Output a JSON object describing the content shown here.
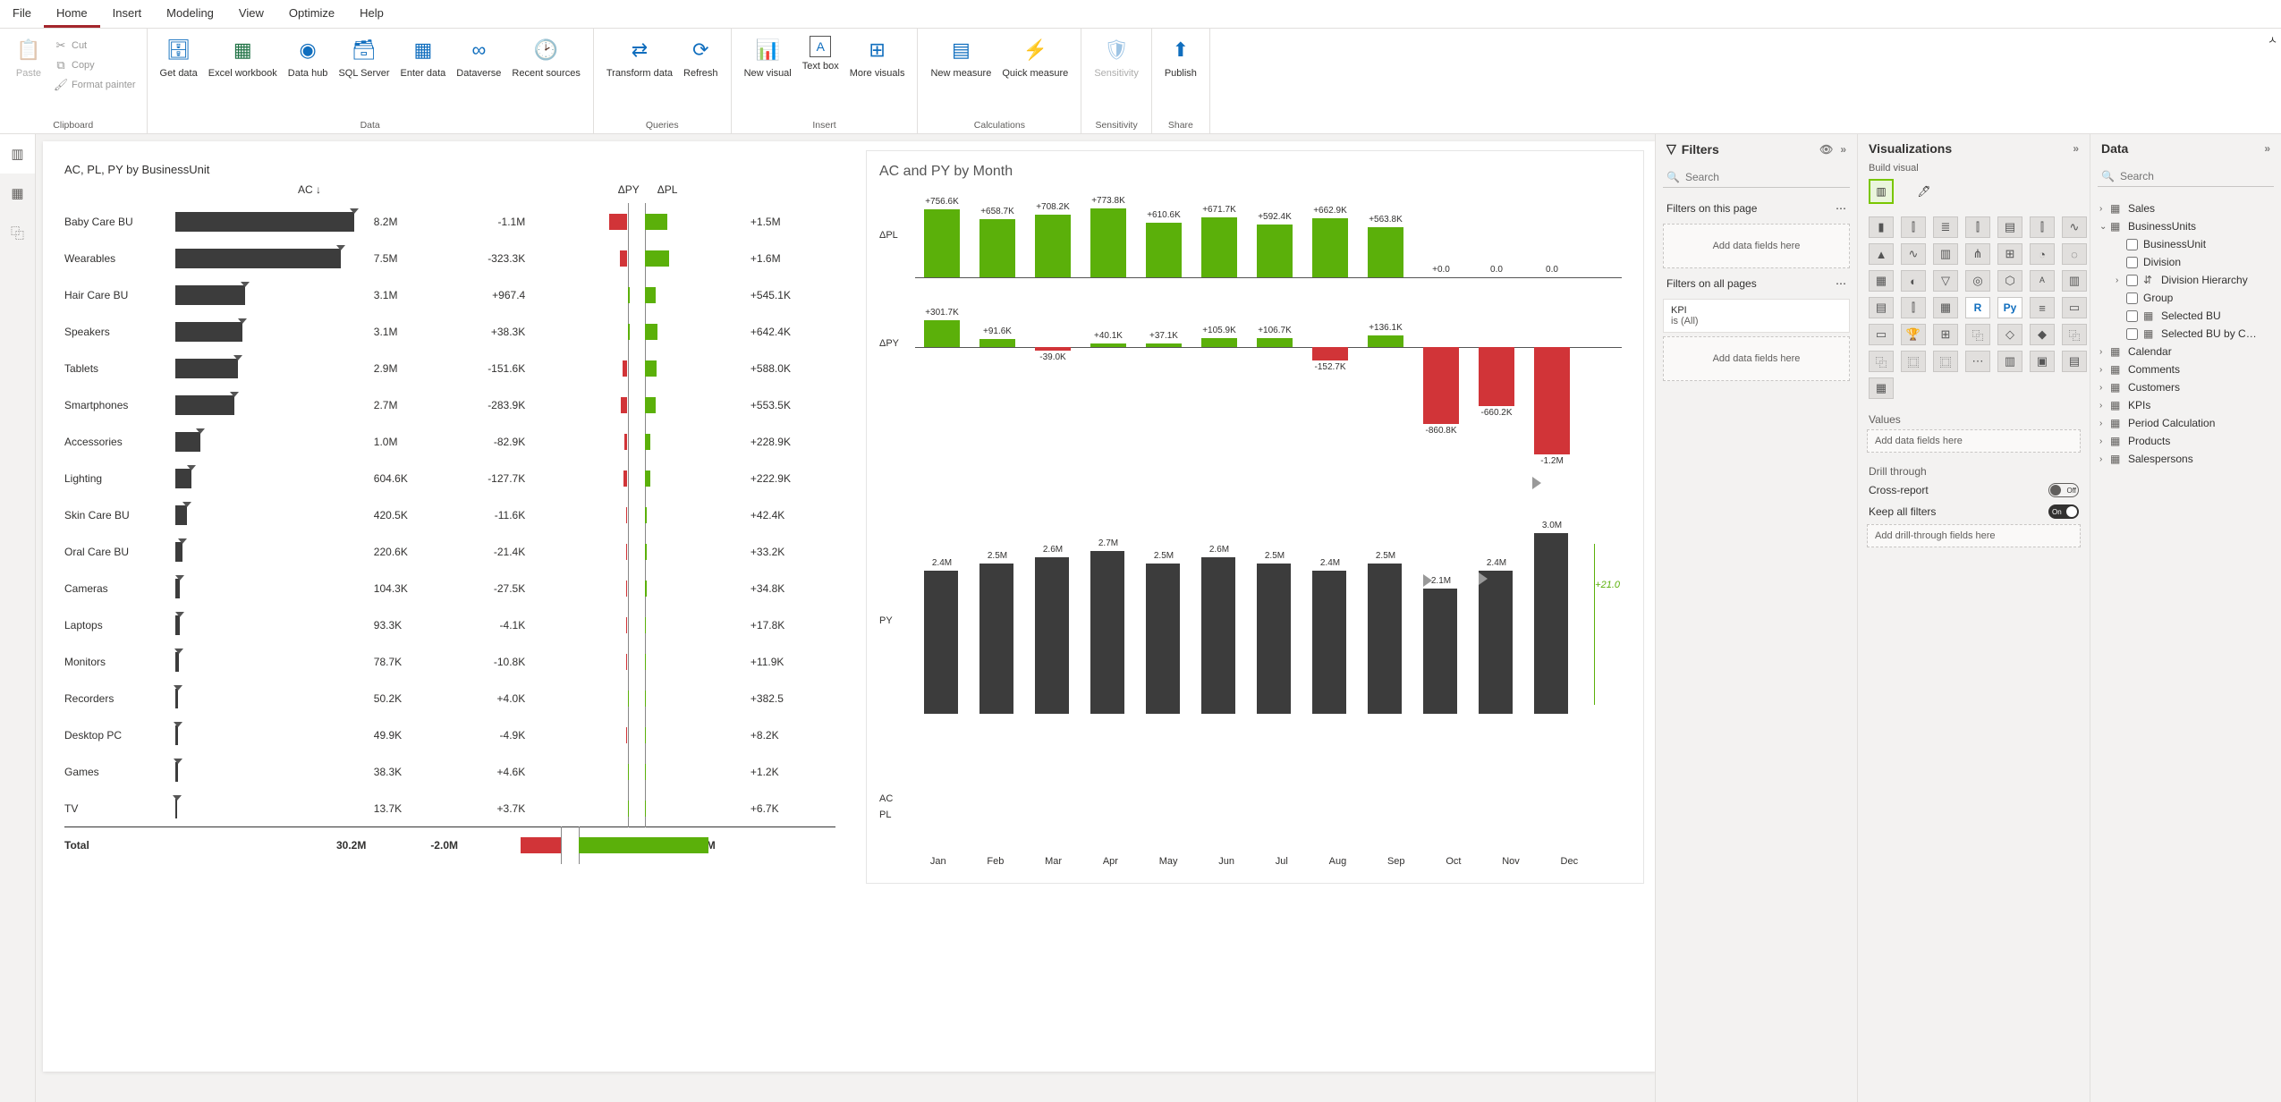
{
  "tabs": [
    "File",
    "Home",
    "Insert",
    "Modeling",
    "View",
    "Optimize",
    "Help"
  ],
  "active_tab": "Home",
  "ribbon": {
    "clipboard": {
      "paste": "Paste",
      "cut": "Cut",
      "copy": "Copy",
      "format_painter": "Format painter",
      "label": "Clipboard"
    },
    "data": {
      "get_data": "Get\ndata",
      "excel": "Excel\nworkbook",
      "data_hub": "Data\nhub",
      "sql": "SQL\nServer",
      "enter": "Enter\ndata",
      "dataverse": "Dataverse",
      "recent": "Recent\nsources",
      "label": "Data"
    },
    "queries": {
      "transform": "Transform\ndata",
      "refresh": "Refresh",
      "label": "Queries"
    },
    "insert": {
      "new_visual": "New\nvisual",
      "text_box": "Text\nbox",
      "more": "More\nvisuals",
      "label": "Insert"
    },
    "calc": {
      "new_measure": "New\nmeasure",
      "quick": "Quick\nmeasure",
      "label": "Calculations"
    },
    "sens": {
      "sensitivity": "Sensitivity",
      "label": "Sensitivity"
    },
    "share": {
      "publish": "Publish",
      "label": "Share"
    }
  },
  "filters_pane": {
    "title": "Filters",
    "search_ph": "Search",
    "on_page": "Filters on this page",
    "add_here": "Add data fields here",
    "on_all": "Filters on all pages",
    "kpi_name": "KPI",
    "kpi_val": "is (All)"
  },
  "viz_pane": {
    "title": "Visualizations",
    "build": "Build visual",
    "values": "Values",
    "values_ph": "Add data fields here",
    "drill": "Drill through",
    "cross": "Cross-report",
    "keep": "Keep all filters",
    "drill_ph": "Add drill-through fields here",
    "off": "Off",
    "on": "On"
  },
  "data_pane": {
    "title": "Data",
    "search_ph": "Search",
    "tables": [
      {
        "name": "Sales",
        "expanded": false
      },
      {
        "name": "BusinessUnits",
        "expanded": true,
        "children": [
          {
            "name": "BusinessUnit"
          },
          {
            "name": "Division"
          },
          {
            "name": "Division Hierarchy",
            "icon": "hier"
          },
          {
            "name": "Group"
          },
          {
            "name": "Selected BU",
            "icon": "table"
          },
          {
            "name": "Selected BU by C…",
            "icon": "table"
          }
        ]
      },
      {
        "name": "Calendar",
        "expanded": false
      },
      {
        "name": "Comments",
        "expanded": false
      },
      {
        "name": "Customers",
        "expanded": false
      },
      {
        "name": "KPIs",
        "expanded": false
      },
      {
        "name": "Period Calculation",
        "expanded": false
      },
      {
        "name": "Products",
        "expanded": false
      },
      {
        "name": "Salespersons",
        "expanded": false
      }
    ]
  },
  "viz_left": {
    "title": "AC, PL, PY by BusinessUnit",
    "headers": {
      "ac": "AC ↓",
      "dpy": "ΔPY",
      "dpl": "ΔPL"
    },
    "rows": [
      {
        "bu": "Baby Care BU",
        "ac": "8.2M",
        "bar": 200,
        "dpy": "-1.1M",
        "dpy_w": -20,
        "dpl": "+1.5M",
        "dpl_w": 25
      },
      {
        "bu": "Wearables",
        "ac": "7.5M",
        "bar": 185,
        "dpy": "-323.3K",
        "dpy_w": -8,
        "dpl": "+1.6M",
        "dpl_w": 27
      },
      {
        "bu": "Hair Care BU",
        "ac": "3.1M",
        "bar": 78,
        "dpy": "+967.4",
        "dpy_w": 2,
        "dpl": "+545.1K",
        "dpl_w": 12
      },
      {
        "bu": "Speakers",
        "ac": "3.1M",
        "bar": 75,
        "dpy": "+38.3K",
        "dpy_w": 2,
        "dpl": "+642.4K",
        "dpl_w": 14
      },
      {
        "bu": "Tablets",
        "ac": "2.9M",
        "bar": 70,
        "dpy": "-151.6K",
        "dpy_w": -5,
        "dpl": "+588.0K",
        "dpl_w": 13
      },
      {
        "bu": "Smartphones",
        "ac": "2.7M",
        "bar": 66,
        "dpy": "-283.9K",
        "dpy_w": -7,
        "dpl": "+553.5K",
        "dpl_w": 12
      },
      {
        "bu": "Accessories",
        "ac": "1.0M",
        "bar": 28,
        "dpy": "-82.9K",
        "dpy_w": -3,
        "dpl": "+228.9K",
        "dpl_w": 6
      },
      {
        "bu": "Lighting",
        "ac": "604.6K",
        "bar": 18,
        "dpy": "-127.7K",
        "dpy_w": -4,
        "dpl": "+222.9K",
        "dpl_w": 6
      },
      {
        "bu": "Skin Care BU",
        "ac": "420.5K",
        "bar": 13,
        "dpy": "-11.6K",
        "dpy_w": -1,
        "dpl": "+42.4K",
        "dpl_w": 2
      },
      {
        "bu": "Oral Care BU",
        "ac": "220.6K",
        "bar": 8,
        "dpy": "-21.4K",
        "dpy_w": -1,
        "dpl": "+33.2K",
        "dpl_w": 2
      },
      {
        "bu": "Cameras",
        "ac": "104.3K",
        "bar": 5,
        "dpy": "-27.5K",
        "dpy_w": -1,
        "dpl": "+34.8K",
        "dpl_w": 2
      },
      {
        "bu": "Laptops",
        "ac": "93.3K",
        "bar": 5,
        "dpy": "-4.1K",
        "dpy_w": -1,
        "dpl": "+17.8K",
        "dpl_w": 1
      },
      {
        "bu": "Monitors",
        "ac": "78.7K",
        "bar": 4,
        "dpy": "-10.8K",
        "dpy_w": -1,
        "dpl": "+11.9K",
        "dpl_w": 1
      },
      {
        "bu": "Recorders",
        "ac": "50.2K",
        "bar": 3,
        "dpy": "+4.0K",
        "dpy_w": 1,
        "dpl": "+382.5",
        "dpl_w": 1
      },
      {
        "bu": "Desktop PC",
        "ac": "49.9K",
        "bar": 3,
        "dpy": "-4.9K",
        "dpy_w": -1,
        "dpl": "+8.2K",
        "dpl_w": 1
      },
      {
        "bu": "Games",
        "ac": "38.3K",
        "bar": 3,
        "dpy": "+4.6K",
        "dpy_w": 1,
        "dpl": "+1.2K",
        "dpl_w": 1
      },
      {
        "bu": "TV",
        "ac": "13.7K",
        "bar": 2,
        "dpy": "+3.7K",
        "dpy_w": 1,
        "dpl": "+6.7K",
        "dpl_w": 1
      }
    ],
    "total": {
      "label": "Total",
      "ac": "30.2M",
      "dpy": "-2.0M",
      "dpy_w": -45,
      "dpl": "+6.0M",
      "dpl_w": 145
    }
  },
  "viz_right": {
    "title": "AC and PY by Month",
    "labels": {
      "dpl": "ΔPL",
      "dpy": "ΔPY",
      "py": "PY",
      "ac": "AC",
      "pl": "PL",
      "delta": "+21.0"
    },
    "months": [
      "Jan",
      "Feb",
      "Mar",
      "Apr",
      "May",
      "Jun",
      "Jul",
      "Aug",
      "Sep",
      "Oct",
      "Nov",
      "Dec"
    ],
    "dpl": [
      "+756.6K",
      "+658.7K",
      "+708.2K",
      "+773.8K",
      "+610.6K",
      "+671.7K",
      "+592.4K",
      "+662.9K",
      "+563.8K",
      "+0.0",
      "0.0",
      "0.0"
    ],
    "dpl_h": [
      76,
      65,
      70,
      77,
      61,
      67,
      59,
      66,
      56,
      0,
      0,
      0
    ],
    "dpy": [
      "+301.7K",
      "+91.6K",
      "-39.0K",
      "+40.1K",
      "+37.1K",
      "+105.9K",
      "+106.7K",
      "-152.7K",
      "+136.1K",
      "-860.8K",
      "-660.2K",
      "-1.2M"
    ],
    "dpy_h": [
      30,
      9,
      -4,
      4,
      4,
      10,
      10,
      -15,
      13,
      -86,
      -66,
      -120
    ],
    "ac_vals": [
      "2.4M",
      "2.5M",
      "2.6M",
      "2.7M",
      "2.5M",
      "2.6M",
      "2.5M",
      "2.4M",
      "2.5M",
      "2.1M",
      "2.4M",
      "3.0M"
    ],
    "ac_h": [
      160,
      168,
      175,
      182,
      168,
      175,
      168,
      160,
      168,
      140,
      160,
      202
    ]
  },
  "chart_data": [
    {
      "type": "bar",
      "title": "AC, PL, PY by BusinessUnit",
      "categories": [
        "Baby Care BU",
        "Wearables",
        "Hair Care BU",
        "Speakers",
        "Tablets",
        "Smartphones",
        "Accessories",
        "Lighting",
        "Skin Care BU",
        "Oral Care BU",
        "Cameras",
        "Laptops",
        "Monitors",
        "Recorders",
        "Desktop PC",
        "Games",
        "TV",
        "Total"
      ],
      "series": [
        {
          "name": "AC",
          "values": [
            8200000,
            7500000,
            3100000,
            3100000,
            2900000,
            2700000,
            1000000,
            604600,
            420500,
            220600,
            104300,
            93300,
            78700,
            50200,
            49900,
            38300,
            13700,
            30200000
          ]
        },
        {
          "name": "ΔPY",
          "values": [
            -1100000,
            -323300,
            967.4,
            38300,
            -151600,
            -283900,
            -82900,
            -127700,
            -11600,
            -21400,
            -27500,
            -4100,
            -10800,
            4000,
            -4900,
            4600,
            3700,
            -2000000
          ]
        },
        {
          "name": "ΔPL",
          "values": [
            1500000,
            1600000,
            545100,
            642400,
            588000,
            553500,
            228900,
            222900,
            42400,
            33200,
            34800,
            17800,
            11900,
            382.5,
            8200,
            1200,
            6700,
            6000000
          ]
        }
      ]
    },
    {
      "type": "bar",
      "title": "AC and PY by Month",
      "categories": [
        "Jan",
        "Feb",
        "Mar",
        "Apr",
        "May",
        "Jun",
        "Jul",
        "Aug",
        "Sep",
        "Oct",
        "Nov",
        "Dec"
      ],
      "series": [
        {
          "name": "ΔPL",
          "values": [
            756600,
            658700,
            708200,
            773800,
            610600,
            671700,
            592400,
            662900,
            563800,
            0,
            0,
            0
          ]
        },
        {
          "name": "ΔPY",
          "values": [
            301700,
            91600,
            -39000,
            40100,
            37100,
            105900,
            106700,
            -152700,
            136100,
            -860800,
            -660200,
            -1200000
          ]
        },
        {
          "name": "AC",
          "values": [
            2400000,
            2500000,
            2600000,
            2700000,
            2500000,
            2600000,
            2500000,
            2400000,
            2500000,
            2100000,
            2400000,
            3000000
          ]
        }
      ],
      "annotation": "+21.0"
    }
  ]
}
